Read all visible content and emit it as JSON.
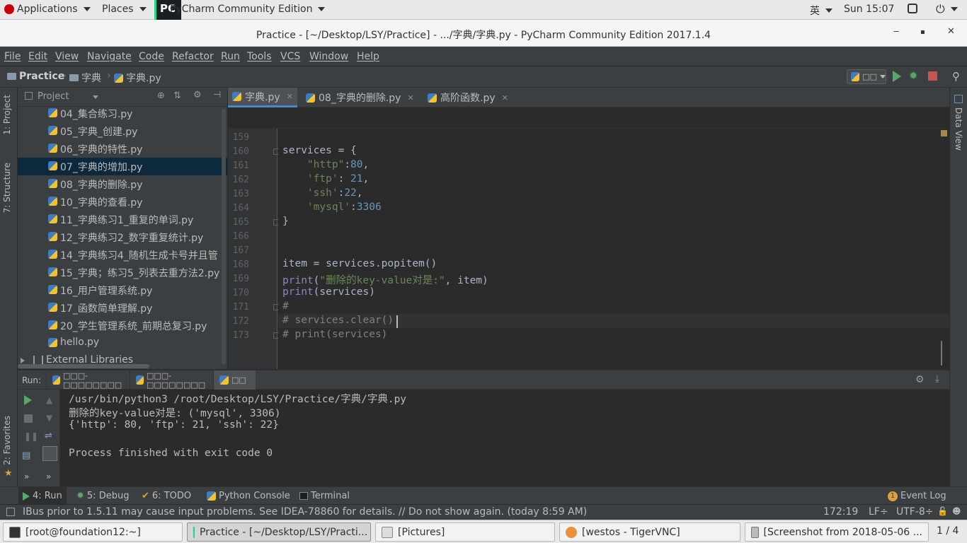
{
  "topbar": {
    "applications": "Applications",
    "places": "Places",
    "active_app": "PyCharm Community Edition",
    "logo_text": "PC",
    "input_method": "英",
    "clock": "Sun 15:07"
  },
  "window": {
    "title": "Practice - [~/Desktop/LSY/Practice] - .../字典/字典.py - PyCharm Community Edition 2017.1.4",
    "minimize": "‒",
    "maximize": "▪",
    "close": "✕"
  },
  "menu": [
    "File",
    "Edit",
    "View",
    "Navigate",
    "Code",
    "Refactor",
    "Run",
    "Tools",
    "VCS",
    "Window",
    "Help"
  ],
  "nav": {
    "crumbs": [
      "Practice",
      "字典",
      "字典.py"
    ],
    "run_config": "□□"
  },
  "left_strip": {
    "project_tab": "1: Project",
    "structure_tab": "7: Structure",
    "favorites_tab": "2: Favorites"
  },
  "right_strip": {
    "data_view_tab": "Data View"
  },
  "project": {
    "header": "Project",
    "files": [
      "04_集合练习.py",
      "05_字典_创建.py",
      "06_字典的特性.py",
      "07_字典的增加.py",
      "08_字典的删除.py",
      "10_字典的查看.py",
      "11_字典练习1_重复的单词.py",
      "12_字典练习2_数字重复统计.py",
      "14_字典练习4_随机生成卡号并且管",
      "15_字典；练习5_列表去重方法2.py",
      "16_用户管理系统.py",
      "17_函数简单理解.py",
      "20_学生管理系统_前期总复习.py",
      "hello.py"
    ],
    "selected_index": 3,
    "external": "External Libraries"
  },
  "editor": {
    "tabs": [
      {
        "label": "字典.py",
        "active": true
      },
      {
        "label": "08_字典的删除.py",
        "active": false
      },
      {
        "label": "高阶函数.py",
        "active": false
      }
    ],
    "line_numbers": [
      "159",
      "160",
      "161",
      "162",
      "163",
      "164",
      "165",
      "166",
      "167",
      "168",
      "169",
      "170",
      "171",
      "172",
      "173"
    ],
    "code": [
      [],
      [
        {
          "t": "services = {",
          "c": ""
        }
      ],
      [
        {
          "t": "    ",
          "c": ""
        },
        {
          "t": "\"http\"",
          "c": "str"
        },
        {
          "t": ":",
          "c": ""
        },
        {
          "t": "80",
          "c": "num"
        },
        {
          "t": ",",
          "c": ""
        }
      ],
      [
        {
          "t": "    ",
          "c": ""
        },
        {
          "t": "'ftp'",
          "c": "str"
        },
        {
          "t": ": ",
          "c": ""
        },
        {
          "t": "21",
          "c": "num"
        },
        {
          "t": ",",
          "c": ""
        }
      ],
      [
        {
          "t": "    ",
          "c": ""
        },
        {
          "t": "'ssh'",
          "c": "str"
        },
        {
          "t": ":",
          "c": ""
        },
        {
          "t": "22",
          "c": "num"
        },
        {
          "t": ",",
          "c": ""
        }
      ],
      [
        {
          "t": "    ",
          "c": ""
        },
        {
          "t": "'mysql'",
          "c": "str"
        },
        {
          "t": ":",
          "c": ""
        },
        {
          "t": "3306",
          "c": "num"
        }
      ],
      [
        {
          "t": "}",
          "c": ""
        }
      ],
      [],
      [],
      [
        {
          "t": "item = services.popitem()",
          "c": ""
        }
      ],
      [
        {
          "t": "print",
          "c": "kw"
        },
        {
          "t": "(",
          "c": ""
        },
        {
          "t": "\"删除的key-value对是:\"",
          "c": "str"
        },
        {
          "t": ", item)",
          "c": ""
        }
      ],
      [
        {
          "t": "print",
          "c": "kw"
        },
        {
          "t": "(services)",
          "c": ""
        }
      ],
      [
        {
          "t": "#",
          "c": "cmt"
        }
      ],
      [
        {
          "t": "# services.clear()",
          "c": "cmt"
        }
      ],
      [
        {
          "t": "# print(services)",
          "c": "cmt"
        }
      ]
    ],
    "current_line_index": 13
  },
  "run": {
    "label": "Run:",
    "tabs": [
      "□□□-□□□□□□□□",
      "□□□-□□□□□□□□",
      "□□"
    ],
    "output": [
      "/usr/bin/python3 /root/Desktop/LSY/Practice/字典/字典.py",
      "删除的key-value对是: ('mysql', 3306)",
      "{'http': 80, 'ftp': 21, 'ssh': 22}",
      "",
      "Process finished with exit code 0"
    ]
  },
  "tool_tabs": {
    "run": "4: Run",
    "debug": "5: Debug",
    "todo": "6: TODO",
    "python_console": "Python Console",
    "terminal": "Terminal",
    "event_log": "Event Log",
    "event_count": "1"
  },
  "status": {
    "message": "IBus prior to 1.5.11 may cause input problems. See IDEA-78860 for details. // Do not show again. (today 8:59 AM)",
    "position": "172:19",
    "line_sep": "LF÷",
    "encoding": "UTF-8÷"
  },
  "taskbar": {
    "items": [
      "[root@foundation12:~]",
      "Practice - [~/Desktop/LSY/Practi...",
      "[Pictures]",
      "[westos - TigerVNC]",
      "[Screenshot from 2018-05-06 ..."
    ],
    "active_index": 1,
    "pager": "1 / 4"
  },
  "colors": {
    "string": "#6a8759",
    "number": "#6897bb",
    "builtin": "#8888c6",
    "comment": "#808080",
    "selection": "#0d293e",
    "run_green": "#59a869"
  }
}
